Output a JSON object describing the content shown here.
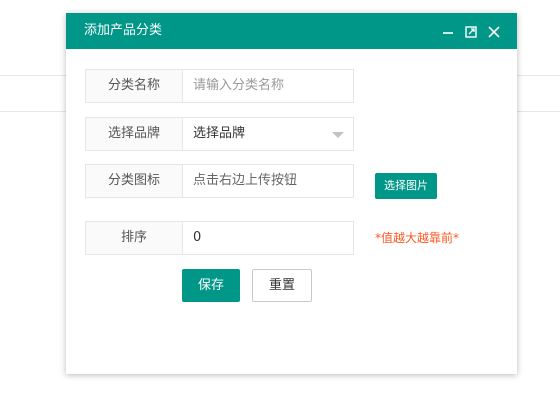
{
  "dialog": {
    "title": "添加产品分类",
    "controls": [
      "minimize-icon",
      "maximize-icon",
      "close-icon"
    ]
  },
  "form": {
    "name": {
      "label": "分类名称",
      "placeholder": "请输入分类名称"
    },
    "brand": {
      "label": "选择品牌",
      "selected": "选择品牌"
    },
    "icon": {
      "label": "分类图标",
      "placeholder": "点击右边上传按钮",
      "button": "选择图片"
    },
    "sort": {
      "label": "排序",
      "value": "0",
      "hint": "*值越大越靠前*"
    }
  },
  "actions": {
    "save": "保存",
    "reset": "重置"
  },
  "colors": {
    "accent": "#009688",
    "hint": "#ff5722"
  }
}
